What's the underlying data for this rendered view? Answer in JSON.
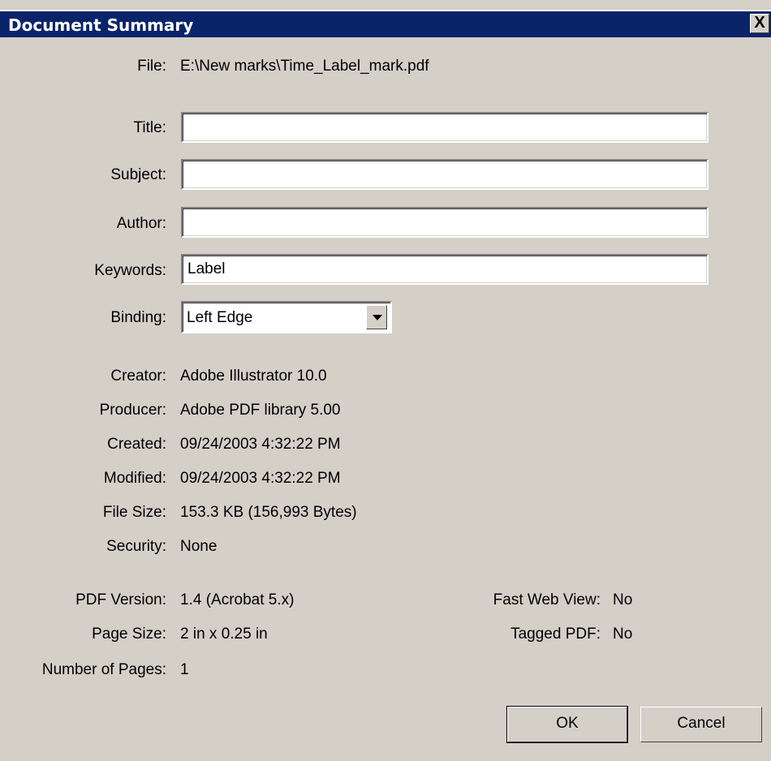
{
  "dialog": {
    "title": "Document Summary",
    "close_label": "X"
  },
  "file": {
    "label": "File:",
    "value": "E:\\New marks\\Time_Label_mark.pdf"
  },
  "fields": {
    "title": {
      "label": "Title:",
      "value": ""
    },
    "subject": {
      "label": "Subject:",
      "value": ""
    },
    "author": {
      "label": "Author:",
      "value": ""
    },
    "keywords": {
      "label": "Keywords:",
      "value": "Label"
    }
  },
  "binding": {
    "label": "Binding:",
    "value": "Left Edge"
  },
  "info": {
    "creator": {
      "label": "Creator:",
      "value": "Adobe Illustrator 10.0"
    },
    "producer": {
      "label": "Producer:",
      "value": "Adobe PDF library 5.00"
    },
    "created": {
      "label": "Created:",
      "value": "09/24/2003 4:32:22 PM"
    },
    "modified": {
      "label": "Modified:",
      "value": "09/24/2003 4:32:22 PM"
    },
    "file_size": {
      "label": "File Size:",
      "value": "153.3 KB (156,993 Bytes)"
    },
    "security": {
      "label": "Security:",
      "value": "None"
    }
  },
  "pdf": {
    "version": {
      "label": "PDF Version:",
      "value": "1.4 (Acrobat 5.x)"
    },
    "page_size": {
      "label": "Page Size:",
      "value": "2 in x 0.25 in"
    },
    "num_pages": {
      "label": "Number of Pages:",
      "value": "1"
    },
    "fast_web_view": {
      "label": "Fast Web View:",
      "value": "No"
    },
    "tagged_pdf": {
      "label": "Tagged PDF:",
      "value": "No"
    }
  },
  "buttons": {
    "ok": "OK",
    "cancel": "Cancel"
  }
}
